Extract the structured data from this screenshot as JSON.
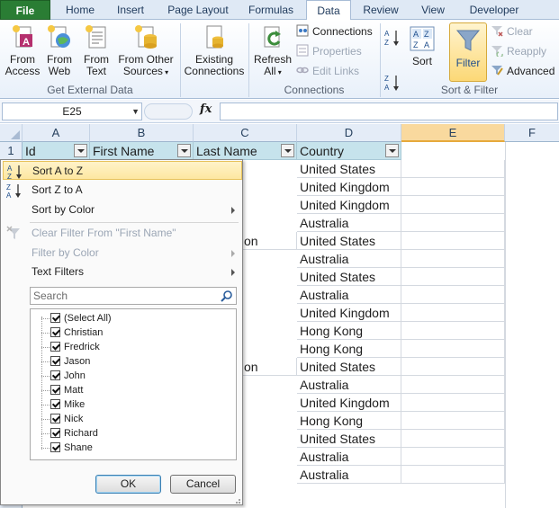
{
  "ribbon_tabs": {
    "file": "File",
    "home": "Home",
    "insert": "Insert",
    "page_layout": "Page Layout",
    "formulas": "Formulas",
    "data": "Data",
    "review": "Review",
    "view": "View",
    "developer": "Developer"
  },
  "get_external_data": {
    "group_label": "Get External Data",
    "from_access": [
      "From",
      "Access"
    ],
    "from_web": [
      "From",
      "Web"
    ],
    "from_text": [
      "From",
      "Text"
    ],
    "from_other": [
      "From Other",
      "Sources"
    ],
    "existing": [
      "Existing",
      "Connections"
    ]
  },
  "connections": {
    "group_label": "Connections",
    "refresh_all": [
      "Refresh",
      "All"
    ],
    "connections_label": "Connections",
    "properties_label": "Properties",
    "edit_links_label": "Edit Links"
  },
  "sort_filter": {
    "group_label": "Sort & Filter",
    "sort_label": "Sort",
    "filter_label": "Filter",
    "clear_label": "Clear",
    "reapply_label": "Reapply",
    "advanced_label": "Advanced"
  },
  "formula_bar": {
    "name_box": "E25",
    "fx": "fx",
    "formula": ""
  },
  "columns": [
    "A",
    "B",
    "C",
    "D",
    "E",
    "F"
  ],
  "table_headers": {
    "id": "Id",
    "first_name": "First Name",
    "last_name": "Last Name",
    "country": "Country"
  },
  "row_numbers": [
    "1"
  ],
  "country_values": [
    "United States",
    "United Kingdom",
    "United Kingdom",
    "Australia",
    "United States",
    "Australia",
    "United States",
    "Australia",
    "United Kingdom",
    "Hong Kong",
    "Hong Kong",
    "United States",
    "Australia",
    "United Kingdom",
    "Hong Kong",
    "United States",
    "Australia",
    "Australia"
  ],
  "partial_last_name": [
    "on",
    "on"
  ],
  "filter_menu": {
    "sort_az": "Sort A to Z",
    "sort_za": "Sort Z to A",
    "sort_by_color": "Sort by Color",
    "clear_filter": "Clear Filter From \"First Name\"",
    "filter_by_color": "Filter by Color",
    "text_filters": "Text Filters",
    "search_placeholder": "Search",
    "items": [
      "(Select All)",
      "Christian",
      "Fredrick",
      "Jason",
      "John",
      "Matt",
      "Mike",
      "Nick",
      "Richard",
      "Shane"
    ],
    "ok": "OK",
    "cancel": "Cancel"
  },
  "colors": {
    "accent": "#2a7d34",
    "header_fill": "#c6e3ec",
    "highlight": "#fde7a1"
  }
}
